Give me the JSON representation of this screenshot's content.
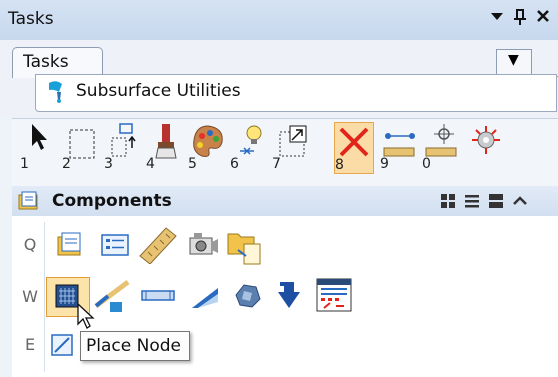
{
  "panel": {
    "title": "Tasks",
    "pin_icon": "pin-icon",
    "close_icon": "close-icon",
    "menu_icon": "chevron-down-icon"
  },
  "tabs": {
    "active_label": "Tasks",
    "dropdown_icon": "chevron-down-icon"
  },
  "task": {
    "label": "Subsurface Utilities",
    "icon": "subsurface-utilities-icon"
  },
  "toolbar": {
    "tools": [
      {
        "num": "1",
        "icon": "element-selection-icon"
      },
      {
        "num": "2",
        "icon": "fence-icon"
      },
      {
        "num": "3",
        "icon": "move-icon"
      },
      {
        "num": "4",
        "icon": "brush-icon"
      },
      {
        "num": "5",
        "icon": "palette-icon"
      },
      {
        "num": "6",
        "icon": "lightbulb-icon"
      },
      {
        "num": "7",
        "icon": "scale-icon"
      },
      {
        "num": "8",
        "icon": "delete-x-icon"
      },
      {
        "num": "9",
        "icon": "measure-icon"
      },
      {
        "num": "0",
        "icon": "dimension-icon"
      },
      {
        "num": "",
        "icon": "snap-target-icon"
      }
    ],
    "active_num": "8"
  },
  "components": {
    "title": "Components",
    "view_icons": [
      "grid-view-icon",
      "list-view-icon",
      "detail-view-icon",
      "collapse-up-icon"
    ],
    "rows": [
      {
        "key": "Q",
        "icons": [
          "components-folder-icon",
          "node-list-icon",
          "ruler-icon",
          "camera-icon",
          "folder-document-icon"
        ]
      },
      {
        "key": "W",
        "icons": [
          "place-node-icon",
          "connector-icon",
          "pipe-icon",
          "cone-icon",
          "rock-icon",
          "arrow-down-icon",
          "report-icon"
        ]
      },
      {
        "key": "E",
        "icons": [
          "edit-icon"
        ]
      }
    ]
  },
  "tooltip": {
    "text": "Place Node"
  }
}
